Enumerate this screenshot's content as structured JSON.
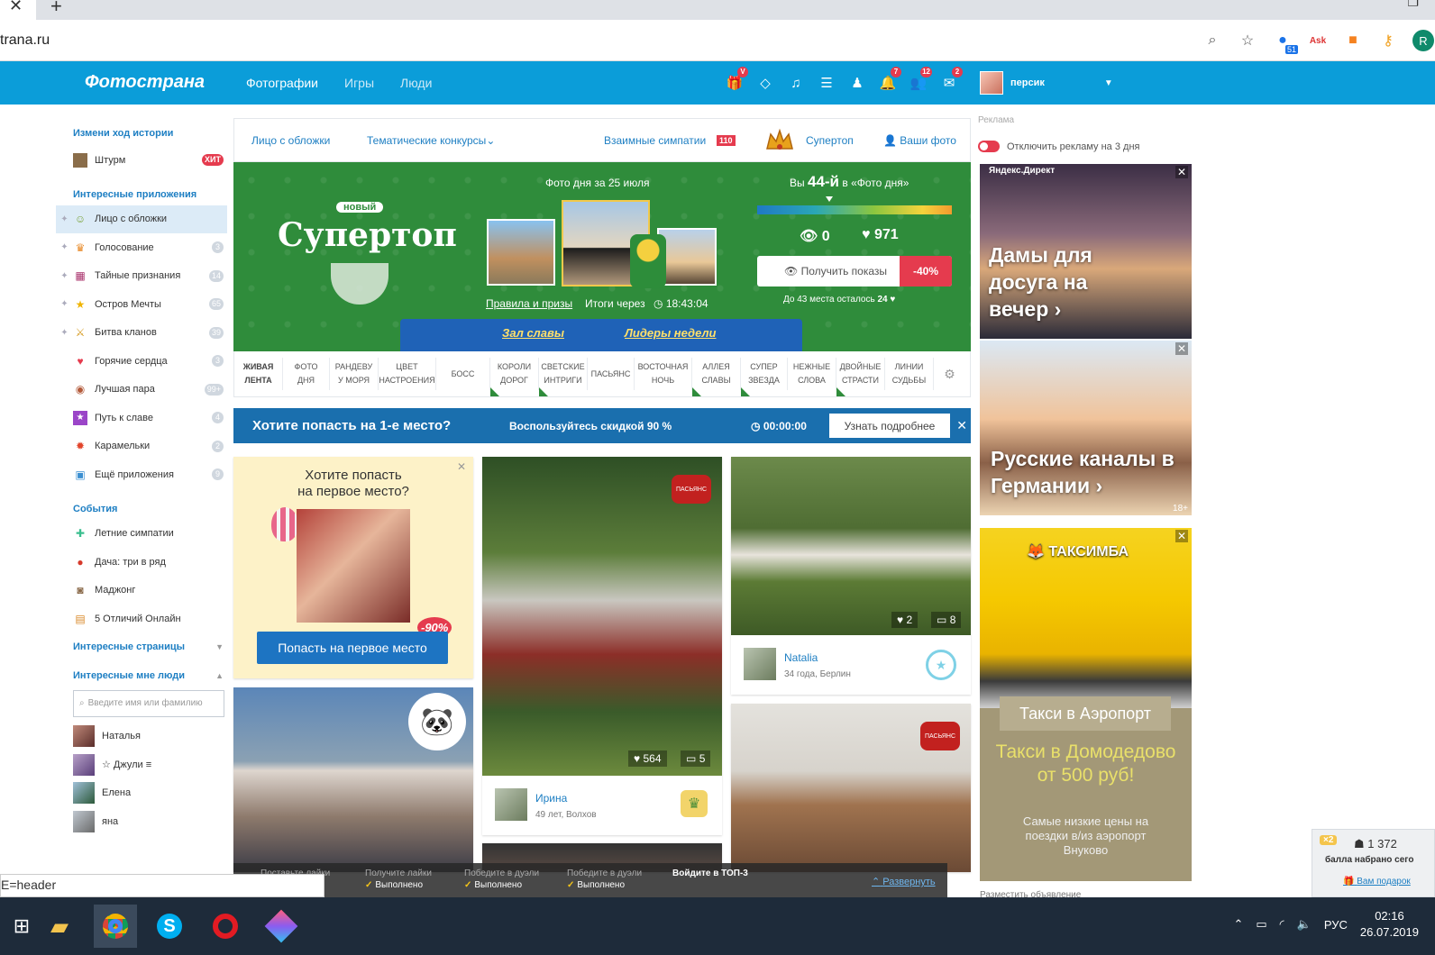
{
  "browser": {
    "url": "trana.ru",
    "ext_badge": "51"
  },
  "header": {
    "logo": "Фотострана",
    "nav": [
      "Фотографии",
      "Игры",
      "Люди"
    ],
    "badges": {
      "gift": "V",
      "bell": "7",
      "people": "12",
      "mail": "2"
    },
    "username": "персик"
  },
  "sidebar": {
    "heading_story": "Измени ход истории",
    "story_item": "Штурм",
    "story_badge": "ХИТ",
    "heading_apps": "Интересные приложения",
    "apps": [
      {
        "label": "Лицо с обложки",
        "badge": ""
      },
      {
        "label": "Голосование",
        "badge": "3"
      },
      {
        "label": "Тайные признания",
        "badge": "14"
      },
      {
        "label": "Остров Мечты",
        "badge": "65"
      },
      {
        "label": "Битва кланов",
        "badge": "39"
      },
      {
        "label": "Горячие сердца",
        "badge": "3"
      },
      {
        "label": "Лучшая пара",
        "badge": "99+"
      },
      {
        "label": "Путь к славе",
        "badge": "4"
      },
      {
        "label": "Карамельки",
        "badge": "2"
      },
      {
        "label": "Ещё приложения",
        "badge": "9"
      }
    ],
    "heading_events": "События",
    "events": [
      "Летние симпатии",
      "Дача: три в ряд",
      "Маджонг",
      "5 Отличий Онлайн"
    ],
    "heading_pages": "Интересные страницы",
    "heading_people": "Интересные мне люди",
    "search_placeholder": "Введите имя или фамилию",
    "people": [
      "Наталья",
      "☆ Джули ≡",
      "Елена",
      "яна"
    ]
  },
  "subnav": {
    "cover": "Лицо с обложки",
    "contests": "Тематические конкурсы",
    "mutual": "Взаимные симпатии",
    "mutual_count": "110",
    "supertop": "Супертоп",
    "your_photos": "Ваши фото"
  },
  "banner": {
    "badge_new": "новый",
    "title": "Супертоп",
    "photo_of_day": "Фото дня за 25 июля",
    "rules": "Правила и призы",
    "results": "Итоги через",
    "timer": "18:43:04",
    "rank_prefix": "Вы",
    "rank_value": "44-й",
    "rank_suffix": "в «Фото дня»",
    "views": "0",
    "likes": "971",
    "get_shows": "Получить показы",
    "discount": "-40%",
    "remain_text": "До 43 места осталось",
    "remain_num": "24",
    "hall_of_fame": "Зал славы",
    "week_leaders": "Лидеры недели"
  },
  "categories": [
    {
      "l1": "ЖИВАЯ",
      "l2": "ЛЕНТА",
      "bold": true,
      "w": 54,
      "tri": false
    },
    {
      "l1": "ФОТО",
      "l2": "ДНЯ",
      "bold": false,
      "w": 52,
      "tri": false
    },
    {
      "l1": "РАНДЕВУ",
      "l2": "У МОРЯ",
      "bold": false,
      "w": 54,
      "tri": false
    },
    {
      "l1": "ЦВЕТ",
      "l2": "НАСТРОЕНИЯ",
      "bold": false,
      "w": 64,
      "tri": false
    },
    {
      "l1": "БОСС",
      "l2": "",
      "bold": false,
      "w": 60,
      "tri": false
    },
    {
      "l1": "КОРОЛИ",
      "l2": "ДОРОГ",
      "bold": false,
      "w": 54,
      "tri": true
    },
    {
      "l1": "СВЕТСКИЕ",
      "l2": "ИНТРИГИ",
      "bold": false,
      "w": 54,
      "tri": true
    },
    {
      "l1": "ПАСЬЯНС",
      "l2": "",
      "bold": false,
      "w": 52,
      "tri": false
    },
    {
      "l1": "ВОСТОЧНАЯ",
      "l2": "НОЧЬ",
      "bold": false,
      "w": 64,
      "tri": false
    },
    {
      "l1": "АЛЛЕЯ",
      "l2": "СЛАВЫ",
      "bold": false,
      "w": 54,
      "tri": true
    },
    {
      "l1": "СУПЕР",
      "l2": "ЗВЕЗДА",
      "bold": false,
      "w": 52,
      "tri": true
    },
    {
      "l1": "НЕЖНЫЕ",
      "l2": "СЛОВА",
      "bold": false,
      "w": 54,
      "tri": false
    },
    {
      "l1": "ДВОЙНЫЕ",
      "l2": "СТРАСТИ",
      "bold": false,
      "w": 54,
      "tri": true
    },
    {
      "l1": "ЛИНИИ",
      "l2": "СУДЬБЫ",
      "bold": false,
      "w": 54,
      "tri": false
    }
  ],
  "promo": {
    "title": "Хотите попасть на 1-е место?",
    "discount": "Воспользуйтесь скидкой 90 %",
    "timer": "00:00:00",
    "more": "Узнать подробнее"
  },
  "feed": {
    "promo_card_title1": "Хотите попасть",
    "promo_card_title2": "на первое место?",
    "promo_card_discount": "-90%",
    "promo_card_button": "Попасть на первое место",
    "card2_likes": "564",
    "card2_comments": "5",
    "card2_name": "Ирина",
    "card2_sub": "49 лет, Волхов",
    "card3_likes": "2",
    "card3_comments": "8",
    "card3_name": "Natalia",
    "card3_sub": "34 года, Берлин",
    "patience": "ПАСЬЯНС"
  },
  "ads": {
    "label": "Реклама",
    "toggle": "Отключить рекламу на 3 дня",
    "ad1_source": "Яндекс.Директ",
    "ad1_text": "Дамы для досуга на вечер ›",
    "ad2_text": "Русские каналы в Германии ›",
    "ad2_age": "18+",
    "ad3_brand": "ТАКСИМБА",
    "ad3_btn": "Такси в Аэропорт",
    "ad3_headline": "Такси в Домодедово от 500 руб!",
    "ad3_sub": "Самые низкие цены на поездки в/из аэропорт Внуково",
    "place_ad": "Разместить объявление"
  },
  "quests": [
    {
      "top": "Поставьте лайки",
      "done": ""
    },
    {
      "top": "Получите лайки",
      "done": "Выполнено"
    },
    {
      "top": "Победите в дуэли",
      "done": "Выполнено"
    },
    {
      "top": "Победите в дуэли",
      "done": "Выполнено"
    },
    {
      "top": "Войдите в ТОП-3",
      "done": ""
    }
  ],
  "quest_expand": "Развернуть",
  "status_url": "E=header",
  "score": {
    "mult": "×2",
    "value": "1 372",
    "label": "балла набрано сего",
    "link": "Вам подарок"
  },
  "taskbar": {
    "lang": "РУС",
    "time": "02:16",
    "date": "26.07.2019"
  }
}
